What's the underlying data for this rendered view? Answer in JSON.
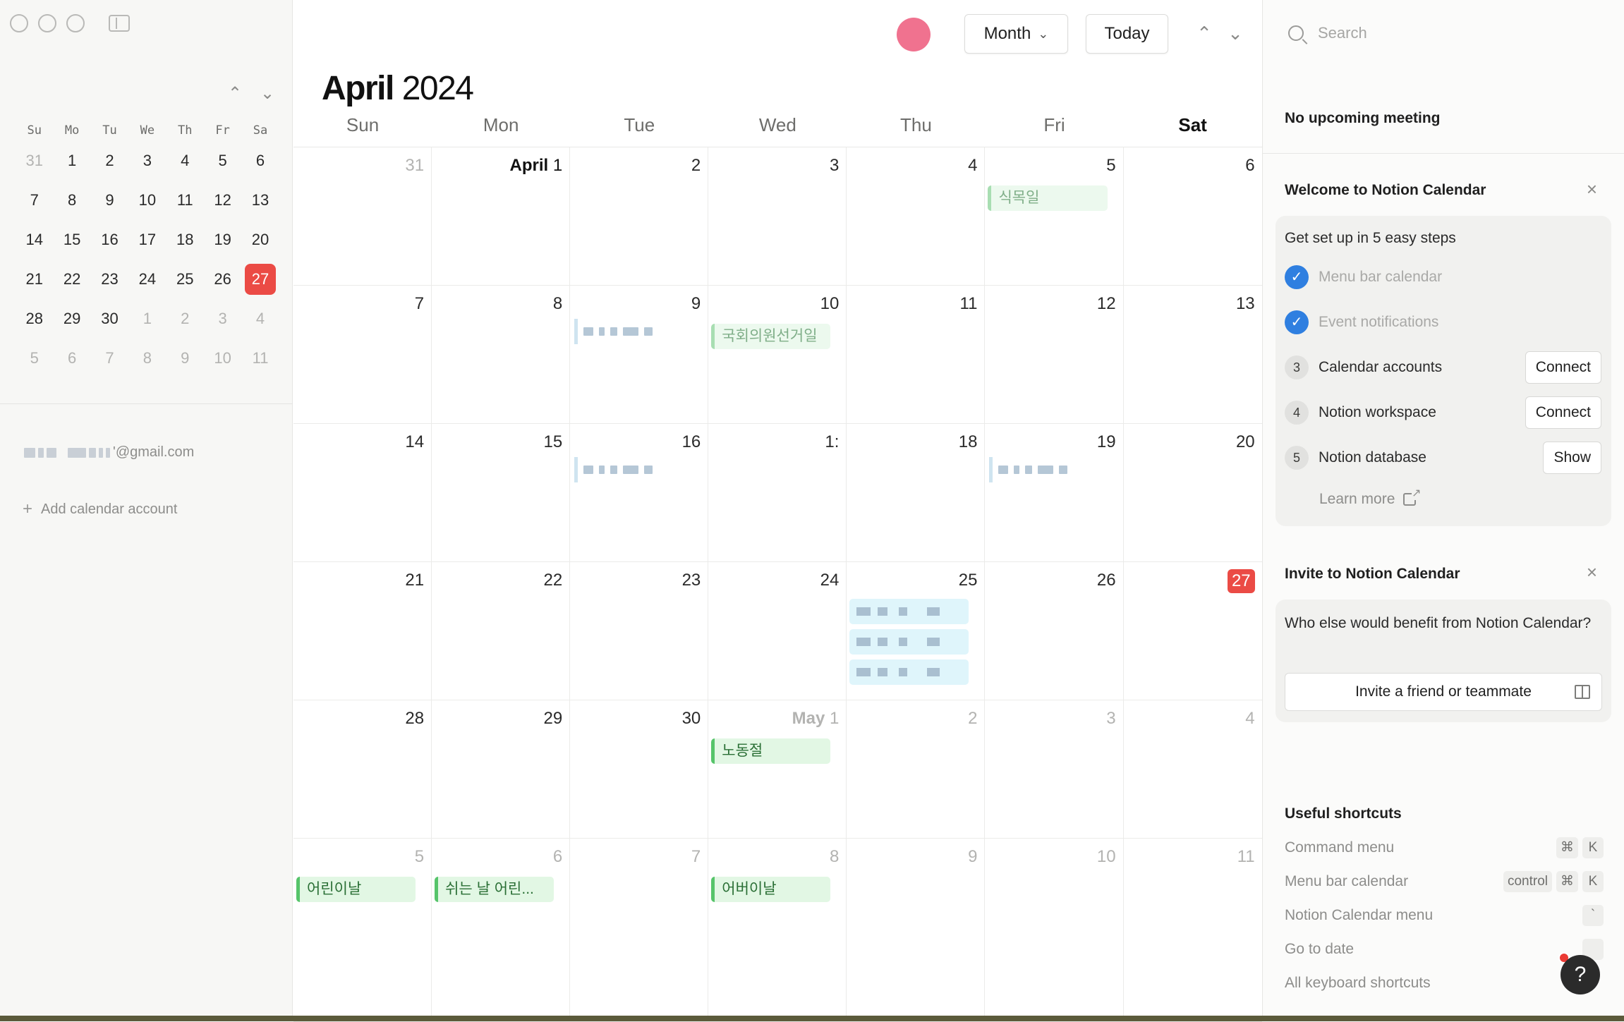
{
  "sidebar": {
    "mini_weekdays": [
      "Su",
      "Mo",
      "Tu",
      "We",
      "Th",
      "Fr",
      "Sa"
    ],
    "mini_weeks": [
      [
        {
          "d": "31",
          "m": true
        },
        {
          "d": "1"
        },
        {
          "d": "2"
        },
        {
          "d": "3"
        },
        {
          "d": "4"
        },
        {
          "d": "5"
        },
        {
          "d": "6"
        }
      ],
      [
        {
          "d": "7"
        },
        {
          "d": "8"
        },
        {
          "d": "9"
        },
        {
          "d": "10"
        },
        {
          "d": "11"
        },
        {
          "d": "12"
        },
        {
          "d": "13"
        }
      ],
      [
        {
          "d": "14"
        },
        {
          "d": "15"
        },
        {
          "d": "16"
        },
        {
          "d": "17"
        },
        {
          "d": "18"
        },
        {
          "d": "19"
        },
        {
          "d": "20"
        }
      ],
      [
        {
          "d": "21"
        },
        {
          "d": "22"
        },
        {
          "d": "23"
        },
        {
          "d": "24"
        },
        {
          "d": "25"
        },
        {
          "d": "26"
        },
        {
          "d": "27",
          "t": true
        }
      ],
      [
        {
          "d": "28"
        },
        {
          "d": "29"
        },
        {
          "d": "30"
        },
        {
          "d": "1",
          "m": true
        },
        {
          "d": "2",
          "m": true
        },
        {
          "d": "3",
          "m": true
        },
        {
          "d": "4",
          "m": true
        }
      ],
      [
        {
          "d": "5",
          "m": true
        },
        {
          "d": "6",
          "m": true
        },
        {
          "d": "7",
          "m": true
        },
        {
          "d": "8",
          "m": true
        },
        {
          "d": "9",
          "m": true
        },
        {
          "d": "10",
          "m": true
        },
        {
          "d": "11",
          "m": true
        }
      ]
    ],
    "account_suffix": "'@gmail.com",
    "add_account_label": "Add calendar account"
  },
  "toolbar": {
    "view_label": "Month",
    "today_label": "Today"
  },
  "header": {
    "month": "April",
    "year": "2024"
  },
  "weekdays": [
    "Sun",
    "Mon",
    "Tue",
    "Wed",
    "Thu",
    "Fri",
    "Sat"
  ],
  "weeks": [
    [
      {
        "d": "31",
        "m": true
      },
      {
        "d": "1",
        "first": "April"
      },
      {
        "d": "2"
      },
      {
        "d": "3"
      },
      {
        "d": "4"
      },
      {
        "d": "5",
        "events": [
          {
            "label": "식목일",
            "style": "faded"
          }
        ]
      },
      {
        "d": "6"
      }
    ],
    [
      {
        "d": "7"
      },
      {
        "d": "8"
      },
      {
        "d": "9",
        "blur": 1
      },
      {
        "d": "10",
        "events": [
          {
            "label": "국회의원선거일",
            "style": "faded"
          }
        ]
      },
      {
        "d": "11"
      },
      {
        "d": "12"
      },
      {
        "d": "13"
      }
    ],
    [
      {
        "d": "14"
      },
      {
        "d": "15"
      },
      {
        "d": "16",
        "blur": 1
      },
      {
        "d": "1:",
        "blurnum": true
      },
      {
        "d": "18"
      },
      {
        "d": "19",
        "blur": 1
      },
      {
        "d": "20"
      }
    ],
    [
      {
        "d": "21"
      },
      {
        "d": "22"
      },
      {
        "d": "23"
      },
      {
        "d": "24"
      },
      {
        "d": "25",
        "blueblur": 3
      },
      {
        "d": "26"
      },
      {
        "d": "27",
        "t": true
      }
    ],
    [
      {
        "d": "28"
      },
      {
        "d": "29"
      },
      {
        "d": "30"
      },
      {
        "d": "1",
        "m": true,
        "first": "May",
        "events": [
          {
            "label": "노동절",
            "style": "normal"
          }
        ]
      },
      {
        "d": "2",
        "m": true
      },
      {
        "d": "3",
        "m": true
      },
      {
        "d": "4",
        "m": true
      }
    ],
    [
      {
        "d": "5",
        "m": true,
        "events": [
          {
            "label": "어린이날",
            "style": "normal"
          }
        ]
      },
      {
        "d": "6",
        "m": true,
        "events": [
          {
            "label": "쉬는 날 어린...",
            "style": "normal"
          }
        ]
      },
      {
        "d": "7",
        "m": true
      },
      {
        "d": "8",
        "m": true,
        "events": [
          {
            "label": "어버이날",
            "style": "normal"
          }
        ]
      },
      {
        "d": "9",
        "m": true
      },
      {
        "d": "10",
        "m": true
      },
      {
        "d": "11",
        "m": true
      }
    ]
  ],
  "panel": {
    "search_placeholder": "Search",
    "no_meeting": "No upcoming meeting",
    "welcome": {
      "title": "Welcome to Notion Calendar",
      "subtitle": "Get set up in 5 easy steps",
      "steps": [
        {
          "label": "Menu bar calendar",
          "done": true
        },
        {
          "label": "Event notifications",
          "done": true
        },
        {
          "num": "3",
          "label": "Calendar accounts",
          "action": "Connect"
        },
        {
          "num": "4",
          "label": "Notion workspace",
          "action": "Connect"
        },
        {
          "num": "5",
          "label": "Notion database",
          "action": "Show"
        }
      ],
      "learn_more": "Learn more"
    },
    "invite": {
      "title": "Invite to Notion Calendar",
      "body": "Who else would benefit from Notion Calendar?",
      "button": "Invite a friend or teammate"
    },
    "shortcuts": {
      "title": "Useful shortcuts",
      "items": [
        {
          "label": "Command menu",
          "keys": [
            "⌘",
            "K"
          ]
        },
        {
          "label": "Menu bar calendar",
          "keys": [
            "control",
            "⌘",
            "K"
          ]
        },
        {
          "label": "Notion Calendar menu",
          "keys": [
            "`"
          ]
        },
        {
          "label": "Go to date",
          "keys": [
            ""
          ]
        },
        {
          "label": "All keyboard shortcuts",
          "keys": []
        }
      ]
    },
    "help_label": "?"
  }
}
